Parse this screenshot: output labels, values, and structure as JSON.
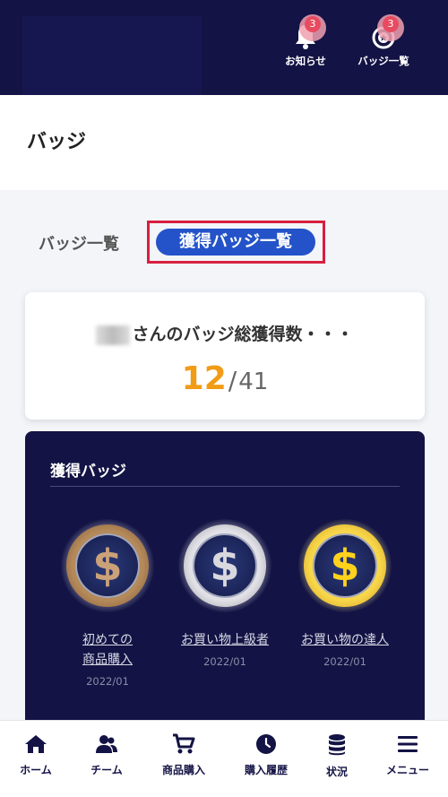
{
  "header": {
    "notifications": {
      "label": "お知らせ",
      "count": "3",
      "icon": "bell-icon"
    },
    "badge_list": {
      "label": "バッジ一覧",
      "count": "3",
      "icon": "medal-icon"
    }
  },
  "page": {
    "title": "バッジ"
  },
  "tabs": [
    {
      "label": "バッジ一覧",
      "active": false
    },
    {
      "label": "獲得バッジ一覧",
      "active": true
    }
  ],
  "summary": {
    "message": "さんのバッジ総獲得数・・・",
    "acquired": "12",
    "separator": "/",
    "total": "41"
  },
  "acquired_badges": {
    "title": "獲得バッジ",
    "items": [
      {
        "name_line1": "初めての",
        "name_line2": "商品購入",
        "date": "2022/01",
        "tier": "bronze",
        "symbol": "$"
      },
      {
        "name_line1": "お買い物上級者",
        "name_line2": "",
        "date": "2022/01",
        "tier": "silver",
        "symbol": "$"
      },
      {
        "name_line1": "お買い物の達人",
        "name_line2": "",
        "date": "2022/01",
        "tier": "gold",
        "symbol": "$"
      }
    ]
  },
  "bottom_nav": [
    {
      "label": "ホーム",
      "icon": "home-icon"
    },
    {
      "label": "チーム",
      "icon": "team-icon"
    },
    {
      "label": "商品購入",
      "icon": "cart-icon"
    },
    {
      "label": "購入履歴",
      "icon": "clock-icon"
    },
    {
      "label": "状況",
      "icon": "database-icon"
    },
    {
      "label": "メニュー",
      "icon": "menu-icon"
    }
  ],
  "colors": {
    "navy": "#131345",
    "accent_blue": "#2453c9",
    "highlight_red": "#d81f3f",
    "count_orange": "#f29b16",
    "badge_red": "#e84b60"
  }
}
